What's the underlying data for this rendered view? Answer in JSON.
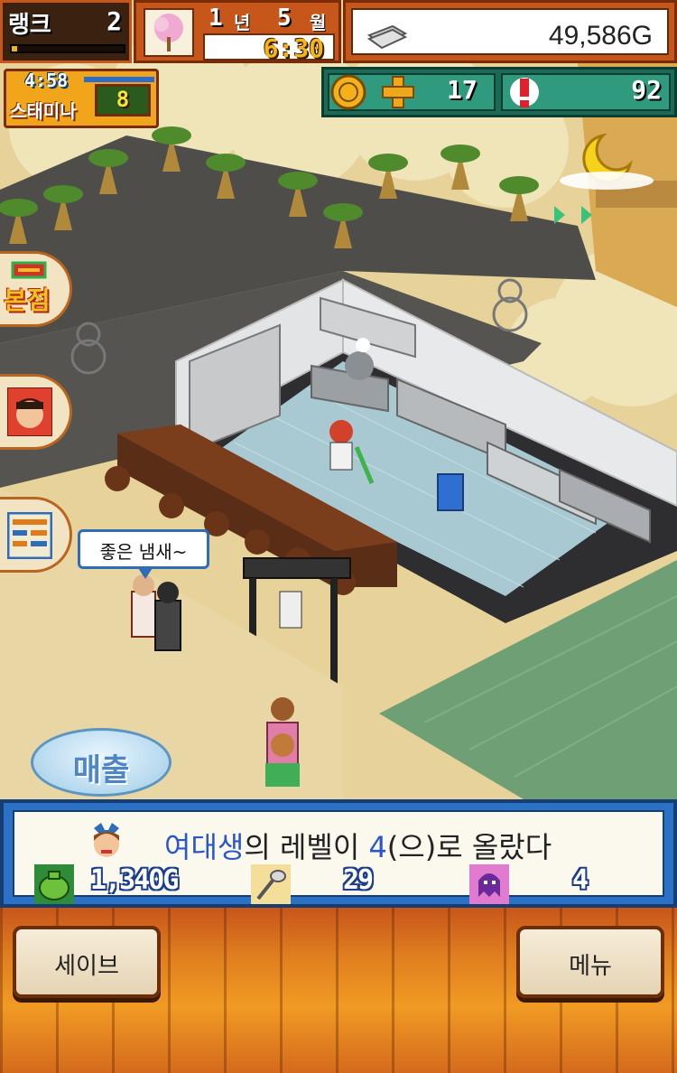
{
  "hud": {
    "rank_label": "랭크",
    "rank_value": "2",
    "rank_progress": 0.05,
    "year": "1",
    "year_unit": "년",
    "month": "5",
    "month_unit": "월",
    "time": "6:30",
    "money": "49,586G",
    "stamina_timer": "4:58",
    "stamina_label": "스태미나",
    "stamina_value": "8",
    "points": "17",
    "fans": "92"
  },
  "side_tabs": {
    "store_label": "본점"
  },
  "speech_bubble": "좋은 냄새~",
  "sales_button": "매출",
  "notification": {
    "subject": "여대생",
    "middle": "의 레벨이 ",
    "level": "4",
    "end": "(으)로 올랐다",
    "reward_money": "1,340G",
    "reward_taste": "29",
    "reward_other": "4"
  },
  "bottom_bar": {
    "save_label": "세이브",
    "menu_label": "메뉴"
  },
  "colors": {
    "hud_orange": "#c7561b",
    "notify_blue": "#2b72c7",
    "stats_green": "#1b6a58",
    "highlight_blue": "#2a57c8"
  }
}
